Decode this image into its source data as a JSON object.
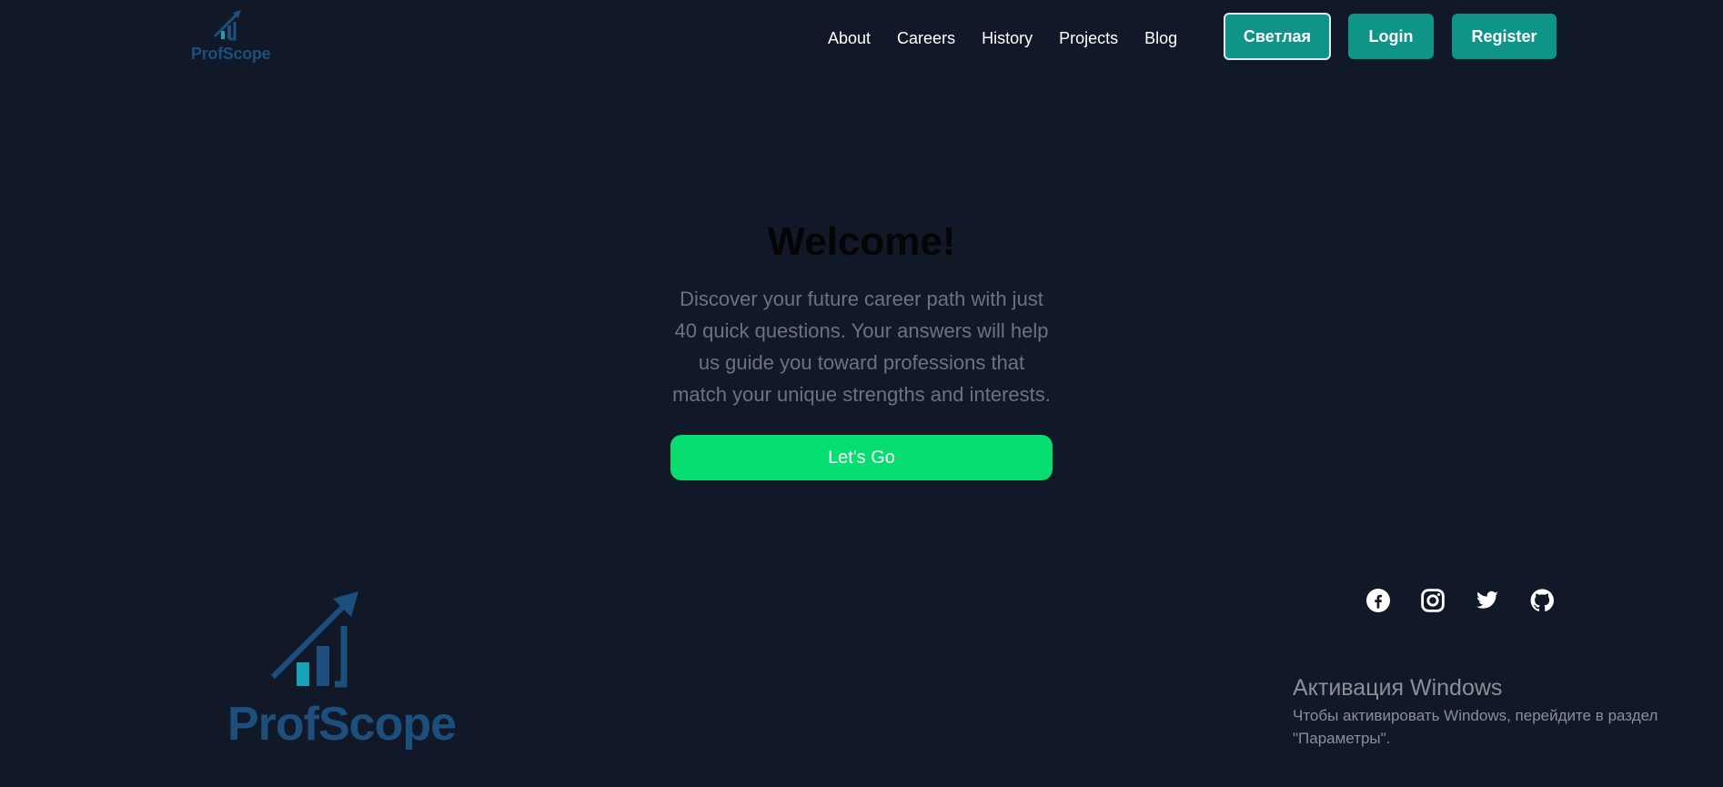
{
  "header": {
    "brand": "ProfScope",
    "nav": [
      "About",
      "Careers",
      "History",
      "Projects",
      "Blog"
    ],
    "theme_button": "Светлая",
    "login_button": "Login",
    "register_button": "Register"
  },
  "hero": {
    "title": "Welcome!",
    "description": "Discover your future career path with just 40 quick questions. Your answers will help us guide you toward professions that match your unique strengths and interests.",
    "cta": "Let's Go"
  },
  "footer": {
    "brand": "ProfScope",
    "socials": [
      "facebook-icon",
      "instagram-icon",
      "twitter-icon",
      "github-icon"
    ]
  },
  "watermark": {
    "title": "Активация Windows",
    "text": "Чтобы активировать Windows, перейдите в раздел \"Параметры\"."
  },
  "colors": {
    "background": "#111827",
    "accent": "#0f9488",
    "cta": "#06de6f",
    "brand_blue": "#1d4f7d",
    "bar_cyan": "#17a2b8"
  }
}
